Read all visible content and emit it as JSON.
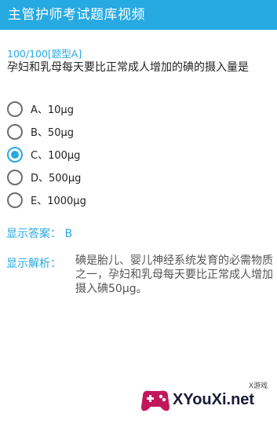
{
  "app_bar": {
    "title": "主管护师考试题库视频"
  },
  "question": {
    "progress": "100/100[题型A]",
    "text": "孕妇和乳母每天要比正常成人增加的碘的摄入量是",
    "selected_index": 2,
    "options": [
      {
        "label": "A、10μg"
      },
      {
        "label": "B、50μg"
      },
      {
        "label": "C、100μg"
      },
      {
        "label": "D、500μg"
      },
      {
        "label": "E、1000μg"
      }
    ]
  },
  "answer": {
    "text": "显示答案：  B"
  },
  "analysis": {
    "label": "显示解析：",
    "text": "碘是胎儿、婴儿神经系统发育的必需物质之一，孕妇和乳母每天要比正常成人增加摄入碘50μg。"
  },
  "watermark": {
    "text": "XYouXi.net",
    "small": "X游戏"
  },
  "colors": {
    "accent": "#27a9e1",
    "text": "#222222",
    "analysis_text": "#555555"
  }
}
